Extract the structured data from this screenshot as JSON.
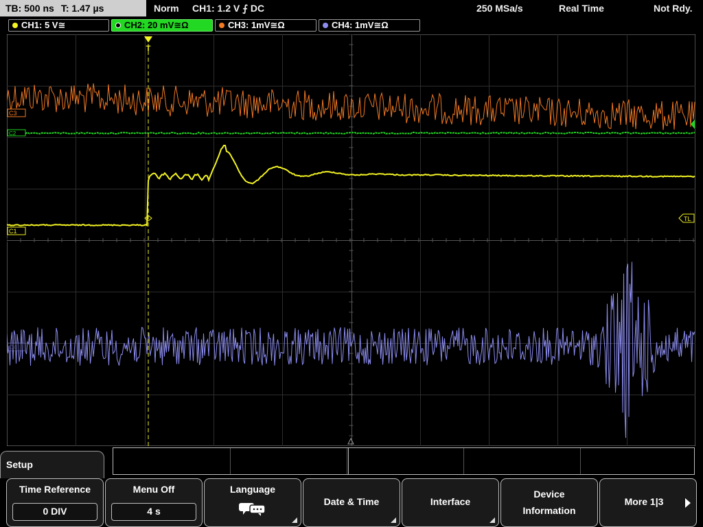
{
  "topbar": {
    "timebase": "TB: 500 ns",
    "trigger_time": "T: 1.47 µs",
    "mode": "Norm",
    "trigger": "CH1: 1.2 V ⨍ DC",
    "sample_rate": "250 MSa/s",
    "acq": "Real Time",
    "status": "Not Rdy."
  },
  "channels": [
    {
      "label": "CH1: 5 V≅",
      "color": "#f4f424"
    },
    {
      "label": "CH2: 20 mV≅Ω",
      "color": "#22d822"
    },
    {
      "label": "CH3: 1mV≅Ω",
      "color": "#f47a24"
    },
    {
      "label": "CH4: 1mV≅Ω",
      "color": "#8c8cf0"
    }
  ],
  "markers": {
    "c3": "C3",
    "c2": "C2",
    "c1": "C1",
    "c4": "C4",
    "tl": "TL",
    "trigger": "T"
  },
  "menu": {
    "tab": "Setup",
    "keys": [
      {
        "label": "Time Reference",
        "value": "0 DIV"
      },
      {
        "label": "Menu Off",
        "value": "4 s"
      },
      {
        "label": "Language",
        "icon": "speech-bubbles-icon"
      },
      {
        "label": "Date & Time"
      },
      {
        "label": "Interface"
      },
      {
        "label": "Device",
        "label2": "Information"
      },
      {
        "label": "More 1|3"
      }
    ]
  }
}
